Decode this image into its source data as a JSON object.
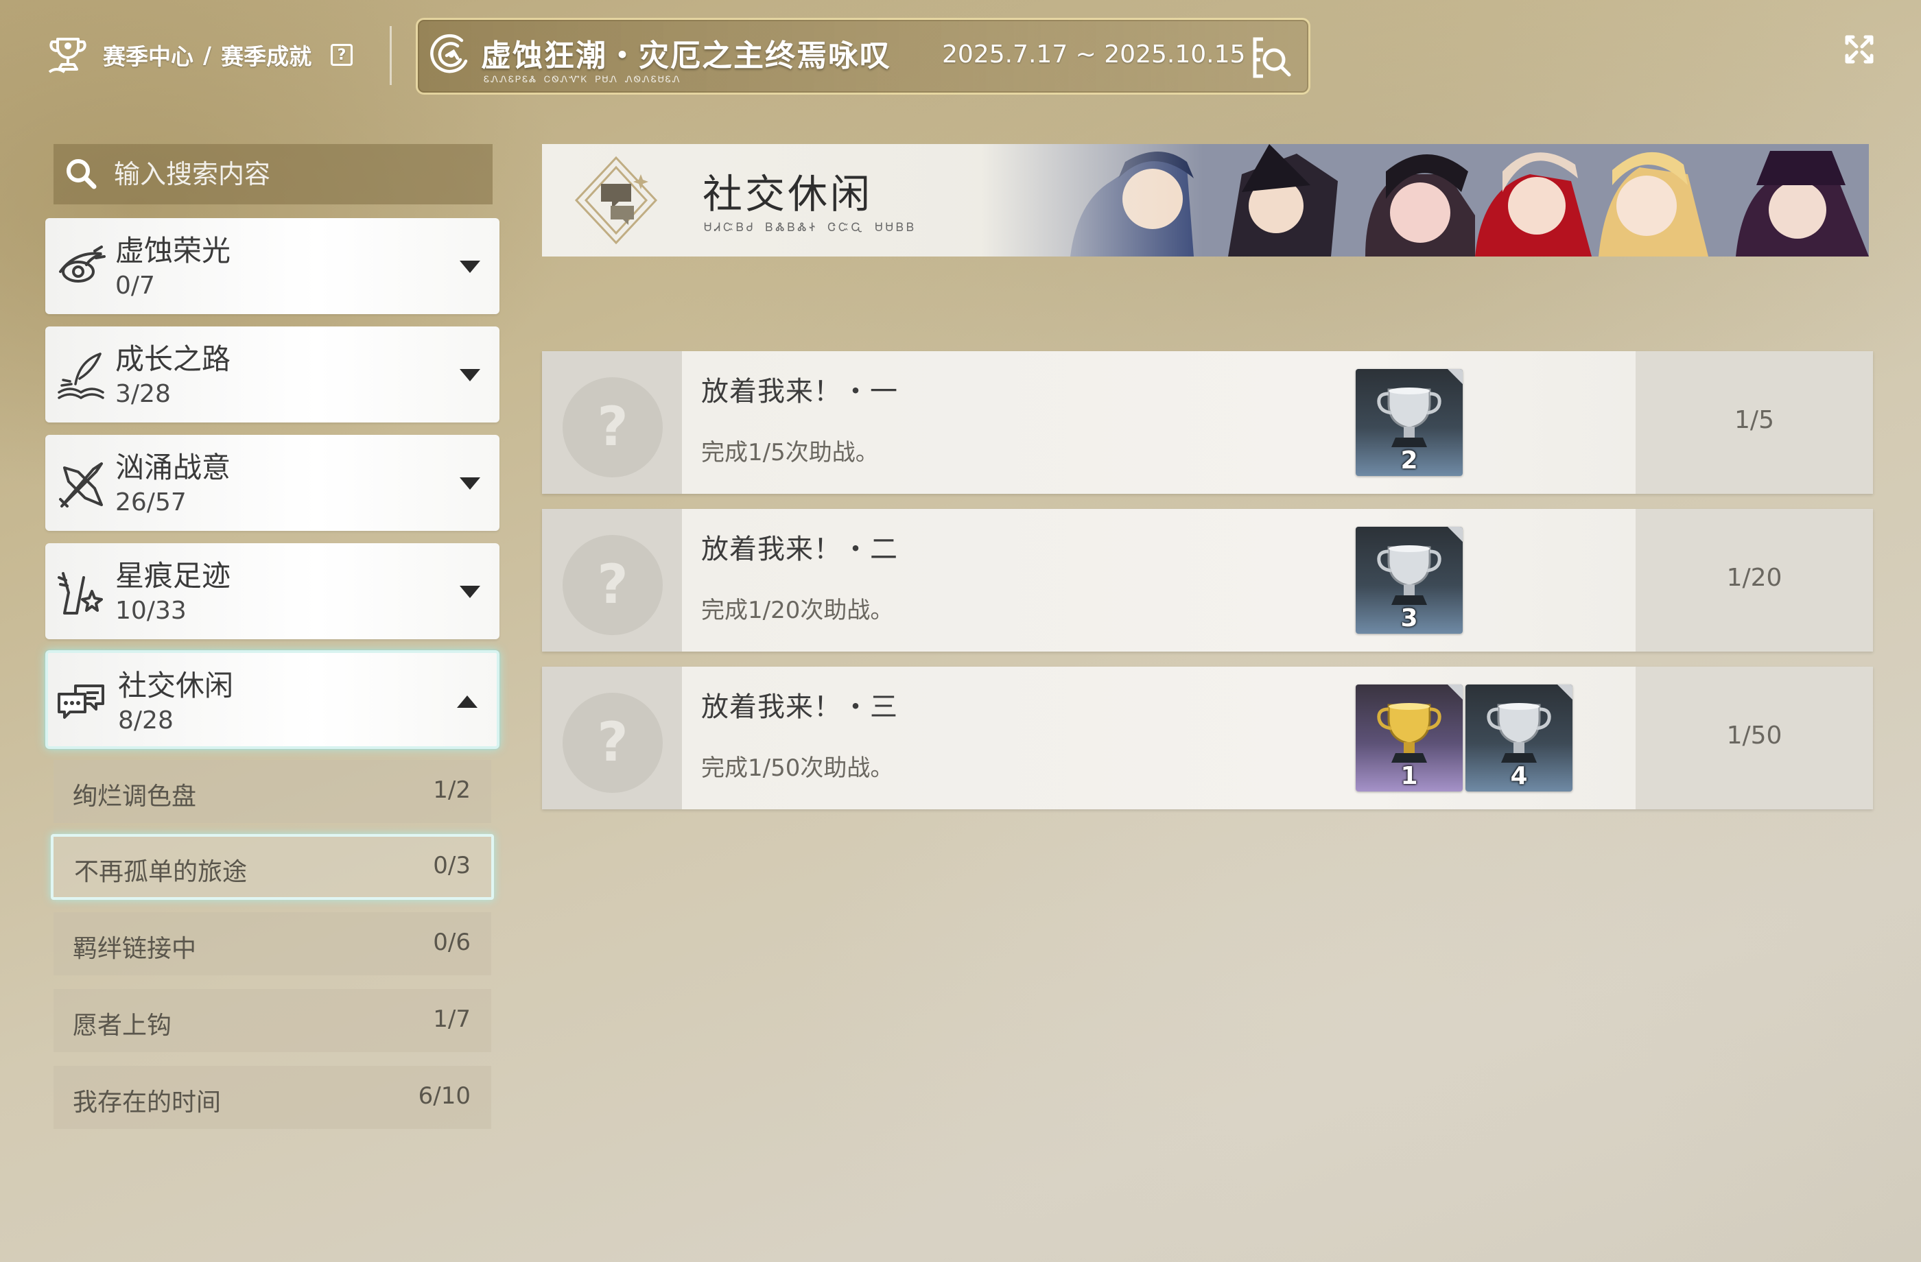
{
  "header": {
    "breadcrumb_home": "赛季中心",
    "breadcrumb_sep": "/",
    "breadcrumb_current": "赛季成就",
    "help_label": "?",
    "season_title": "虚蚀狂潮・灾厄之主终焉咏叹",
    "season_subtitle": "ᏋᏁᏁᏋᏢᏋᏜ ᏟᏫᏁᏉᏦ ᏢᏌᏁ ᏁᏫᏁᏋᏌᏋᏁ",
    "season_dates": "2025.7.17 ~ 2025.10.15"
  },
  "search": {
    "placeholder": "输入搜索内容"
  },
  "categories": [
    {
      "name": "虚蚀荣光",
      "count": "0/7",
      "icon": "eye-swirl-icon",
      "expanded": false
    },
    {
      "name": "成长之路",
      "count": "3/28",
      "icon": "quill-book-icon",
      "expanded": false
    },
    {
      "name": "汹涌战意",
      "count": "26/57",
      "icon": "crossed-weapons-icon",
      "expanded": false
    },
    {
      "name": "星痕足迹",
      "count": "10/33",
      "icon": "boot-star-icon",
      "expanded": false
    },
    {
      "name": "社交休闲",
      "count": "8/28",
      "icon": "chat-bubbles-icon",
      "expanded": true
    }
  ],
  "subcategories": [
    {
      "name": "绚烂调色盘",
      "count": "1/2",
      "selected": false
    },
    {
      "name": "不再孤单的旅途",
      "count": "0/3",
      "selected": true
    },
    {
      "name": "羁绊链接中",
      "count": "0/6",
      "selected": false
    },
    {
      "name": "愿者上钩",
      "count": "1/7",
      "selected": false
    },
    {
      "name": "我存在的时间",
      "count": "6/10",
      "selected": false
    }
  ],
  "banner": {
    "title": "社交休闲",
    "subtitle": "ᏌᏗᏨᏴᏧ ᏴᏜᏴᏜᏐ ᏣᏨᏩ ᏌᏌᏴᏴ"
  },
  "achievements": [
    {
      "title": "放着我来！・一",
      "description": "完成1/5次助战。",
      "progress": "1/5",
      "locked_icon": "?",
      "rewards": [
        {
          "type": "silver-trophy-icon",
          "qty": "2"
        }
      ]
    },
    {
      "title": "放着我来！・二",
      "description": "完成1/20次助战。",
      "progress": "1/20",
      "locked_icon": "?",
      "rewards": [
        {
          "type": "silver-trophy-icon",
          "qty": "3"
        }
      ]
    },
    {
      "title": "放着我来！・三",
      "description": "完成1/50次助战。",
      "progress": "1/50",
      "locked_icon": "?",
      "rewards": [
        {
          "type": "gold-trophy-icon",
          "qty": "1"
        },
        {
          "type": "silver-trophy-icon",
          "qty": "4"
        }
      ]
    }
  ],
  "colors": {
    "highlight_glow": "#d8f3f0",
    "panel_border": "#f0e1aa",
    "text_dark": "#3a3a3a"
  }
}
